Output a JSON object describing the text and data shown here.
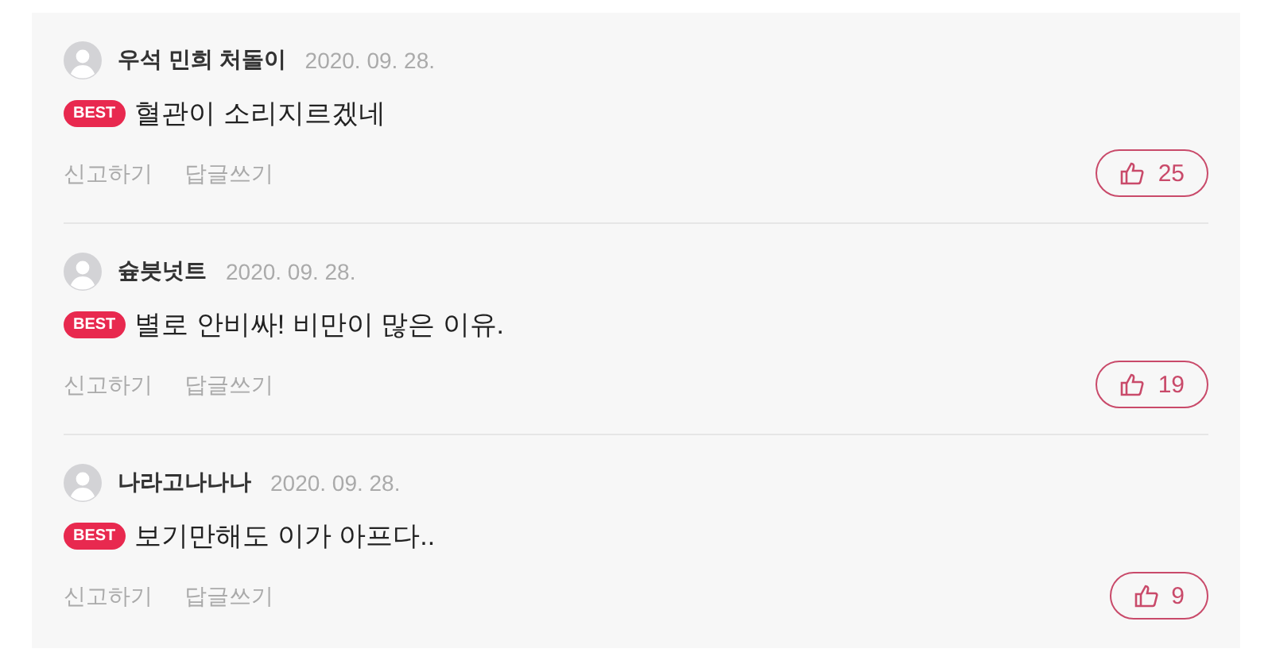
{
  "comments": [
    {
      "author": "우석 민희 처돌이",
      "date": "2020. 09. 28.",
      "best": true,
      "badge": "BEST",
      "text": "혈관이 소리지르겠네",
      "actions": [
        "신고하기",
        "답글쓰기"
      ],
      "likes": "25"
    },
    {
      "author": "슢븟넛트",
      "date": "2020. 09. 28.",
      "best": true,
      "badge": "BEST",
      "text": "별로 안비싸! 비만이 많은 이유.",
      "actions": [
        "신고하기",
        "답글쓰기"
      ],
      "likes": "19"
    },
    {
      "author": "나라고나나나",
      "date": "2020. 09. 28.",
      "best": true,
      "badge": "BEST",
      "text": "보기만해도 이가 아프다..",
      "actions": [
        "신고하기",
        "답글쓰기"
      ],
      "likes": "9"
    }
  ]
}
